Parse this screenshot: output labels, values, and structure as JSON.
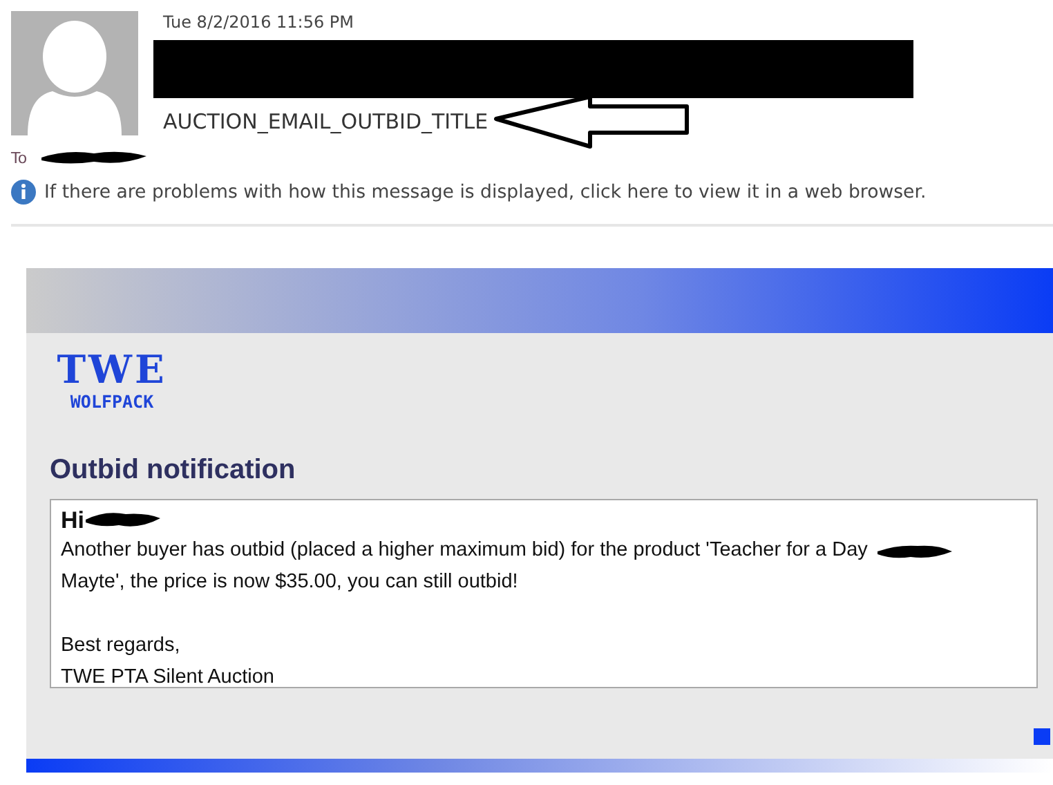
{
  "header": {
    "date": "Tue 8/2/2016 11:56 PM",
    "subject": "AUCTION_EMAIL_OUTBID_TITLE",
    "to_label": "To",
    "info": "If there are problems with how this message is displayed, click here to view it in a web browser."
  },
  "email": {
    "logo": {
      "initials": "TWE",
      "team": "WOLFPACK"
    },
    "heading": "Outbid notification",
    "greeting": "Hi",
    "body_line_1": "Another buyer has outbid (placed a higher maximum bid) for the product 'Teacher for a Day",
    "body_line_2": "Mayte', the price is now $35.00, you can still outbid!",
    "closing": "Best regards,",
    "signature": "TWE PTA Silent Auction"
  }
}
